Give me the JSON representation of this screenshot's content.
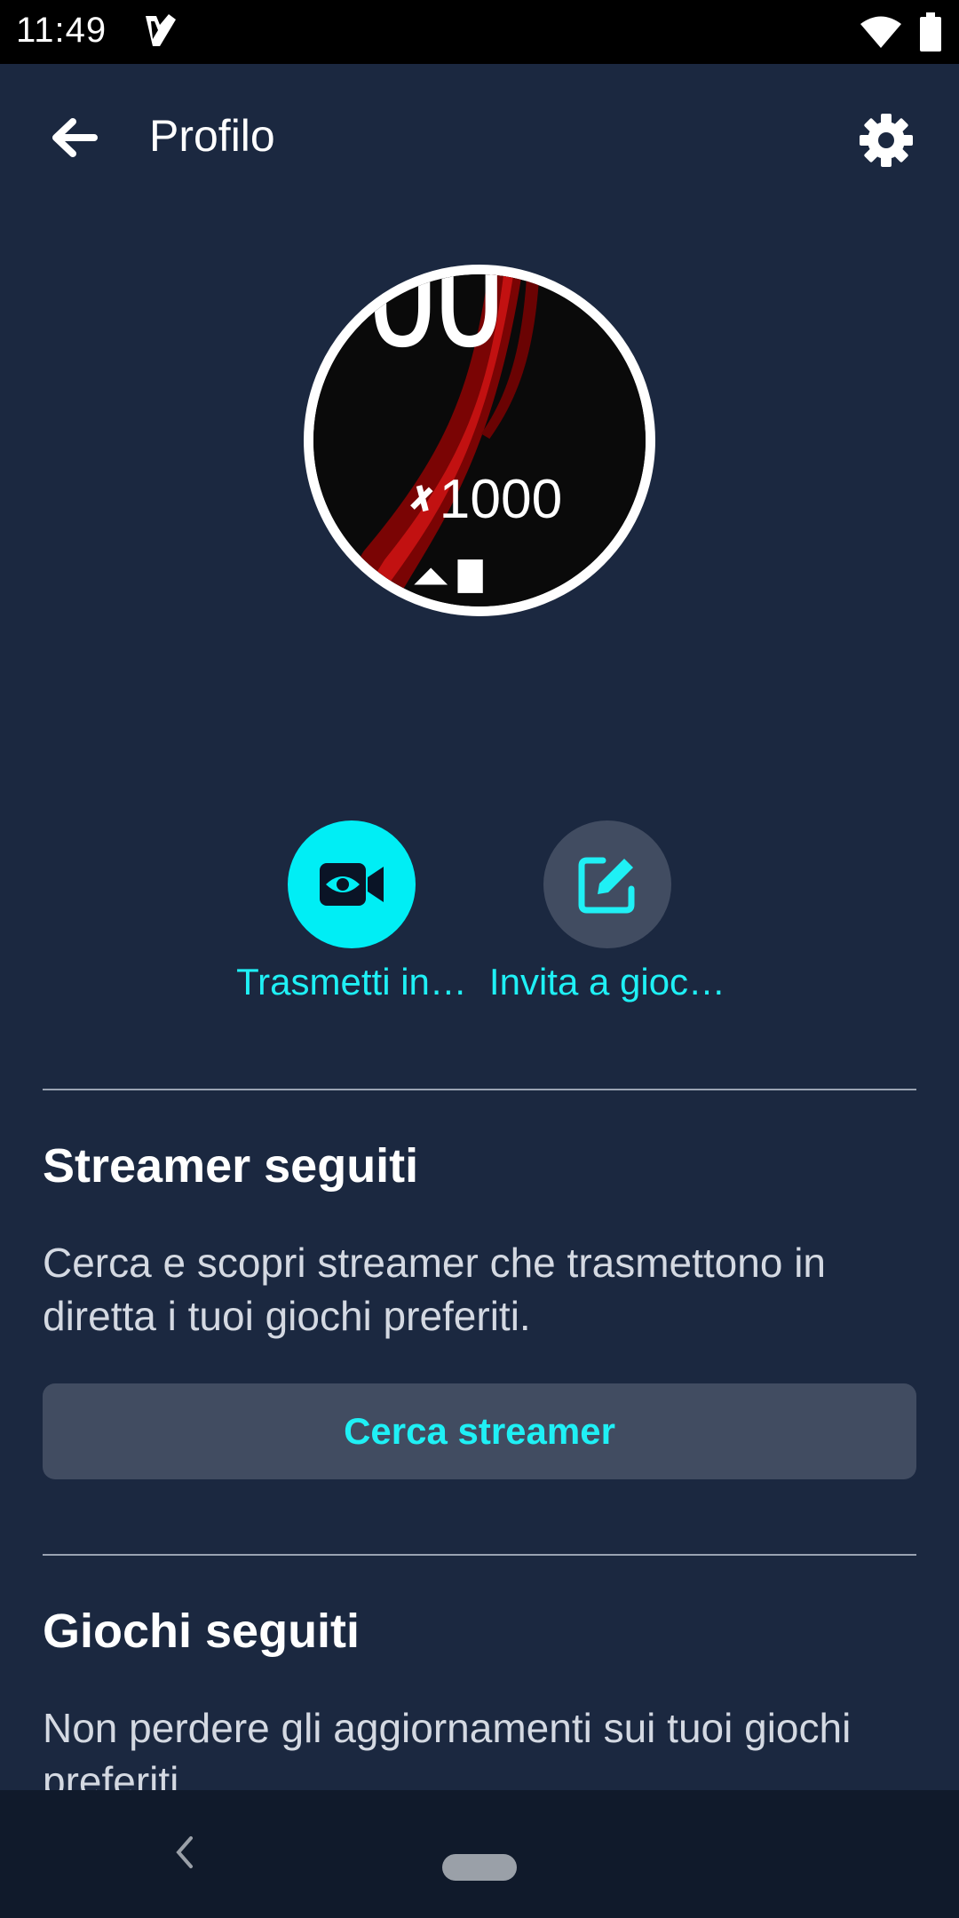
{
  "status_bar": {
    "time": "11:49",
    "icons": [
      "notification-icon",
      "wifi-icon",
      "battery-icon"
    ]
  },
  "header": {
    "title": "Profilo",
    "back_icon": "arrow-left-icon",
    "settings_icon": "gear-icon"
  },
  "avatar": {
    "image_text": "1000"
  },
  "actions": [
    {
      "label": "Trasmetti in…",
      "icon": "video-camera-eye-icon"
    },
    {
      "label": "Invita a gioc…",
      "icon": "edit-icon"
    }
  ],
  "sections": {
    "streamers": {
      "title": "Streamer seguiti",
      "description": "Cerca e scopri streamer che trasmettono in diretta i tuoi giochi preferiti.",
      "button_label": "Cerca streamer"
    },
    "games": {
      "title": "Giochi seguiti",
      "description": "Non perdere gli aggiornamenti sui tuoi giochi preferiti."
    }
  },
  "colors": {
    "background": "#1b2840",
    "accent": "#1ff0f5",
    "button_bg": "#414c61",
    "nav_bar": "#101a2b"
  }
}
